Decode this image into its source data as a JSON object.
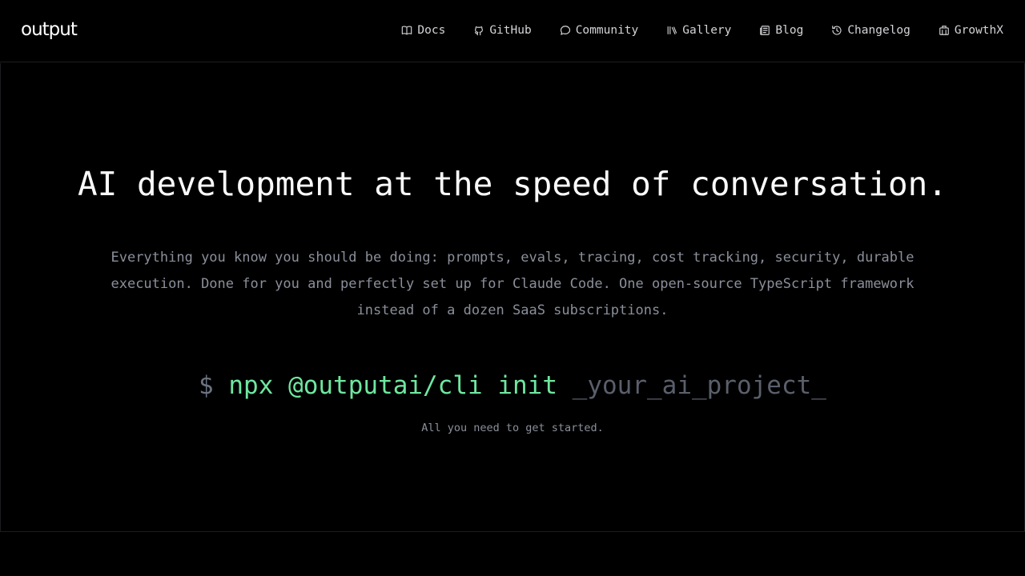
{
  "nav": {
    "logo": "output",
    "links": [
      {
        "label": "Docs",
        "icon": "book-icon"
      },
      {
        "label": "GitHub",
        "icon": "github-icon"
      },
      {
        "label": "Community",
        "icon": "chat-bubble-icon"
      },
      {
        "label": "Gallery",
        "icon": "library-icon"
      },
      {
        "label": "Blog",
        "icon": "newspaper-icon"
      },
      {
        "label": "Changelog",
        "icon": "history-icon"
      },
      {
        "label": "GrowthX",
        "icon": "building-icon"
      }
    ]
  },
  "hero": {
    "headline": "AI development at the speed of conversation.",
    "subtitle": "Everything you know you should be doing: prompts, evals, tracing, cost tracking, security, durable execution. Done for you and perfectly set up for Claude Code. One open-source TypeScript framework instead of a dozen SaaS subscriptions.",
    "command": {
      "prompt": "$",
      "text": "npx @outputai/cli init",
      "placeholder": "_your_ai_project_"
    },
    "caption": "All you need to get started."
  },
  "colors": {
    "background": "#000000",
    "command_green": "#6ee7a0",
    "muted_text": "#8b8f9a"
  }
}
